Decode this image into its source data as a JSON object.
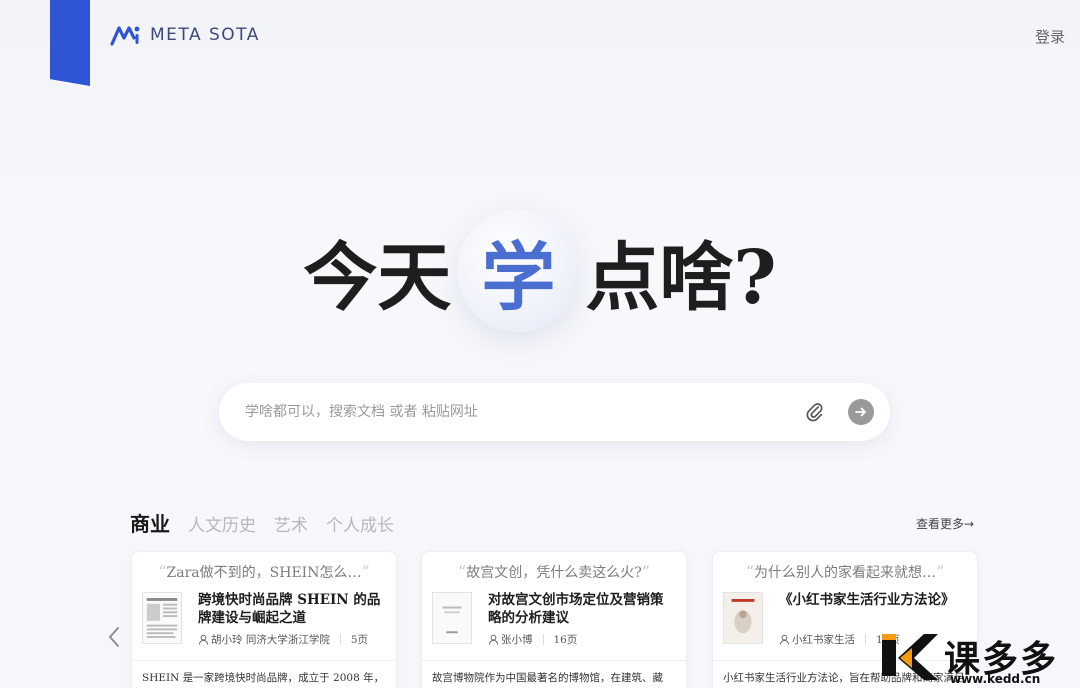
{
  "header": {
    "logo_text": "META SOTA",
    "login_label": "登录"
  },
  "hero": {
    "before": "今天",
    "highlight": "学",
    "after": "点啥?"
  },
  "search": {
    "placeholder": "学啥都可以，搜索文档 或者 粘贴网址",
    "attach_icon": "paperclip-icon",
    "submit_icon": "arrow-right-icon"
  },
  "tabs": [
    {
      "label": "商业",
      "active": true
    },
    {
      "label": "人文历史",
      "active": false
    },
    {
      "label": "艺术",
      "active": false
    },
    {
      "label": "个人成长",
      "active": false
    }
  ],
  "more_label": "查看更多→",
  "cards": [
    {
      "quote": "Zara做不到的，SHEIN怎么…",
      "title": "跨境快时尚品牌 SHEIN 的品牌建设与崛起之道",
      "author": "胡小玲 同济大学浙江学院",
      "pages": "5页",
      "desc": "SHEIN 是一家跨境快时尚品牌，成立于 2008 年，最"
    },
    {
      "quote": "故宫文创，凭什么卖这么火?",
      "title": "对故宫文创市场定位及营销策略的分析建议",
      "author": "张小博",
      "pages": "16页",
      "desc": "故宫博物院作为中国最著名的博物馆，在建筑、藏"
    },
    {
      "quote": "为什么别人的家看起来就想…",
      "title": "《小红书家生活行业方法论》",
      "author": "小红书家生活",
      "pages": "13页",
      "desc": "小红书家生活行业方法论，旨在帮助品牌和商家满足"
    }
  ],
  "watermark": {
    "text": "课多多",
    "url": "www.kedd.cn"
  },
  "colors": {
    "accent": "#2f54d6",
    "hero_highlight": "#4a6fd0"
  }
}
